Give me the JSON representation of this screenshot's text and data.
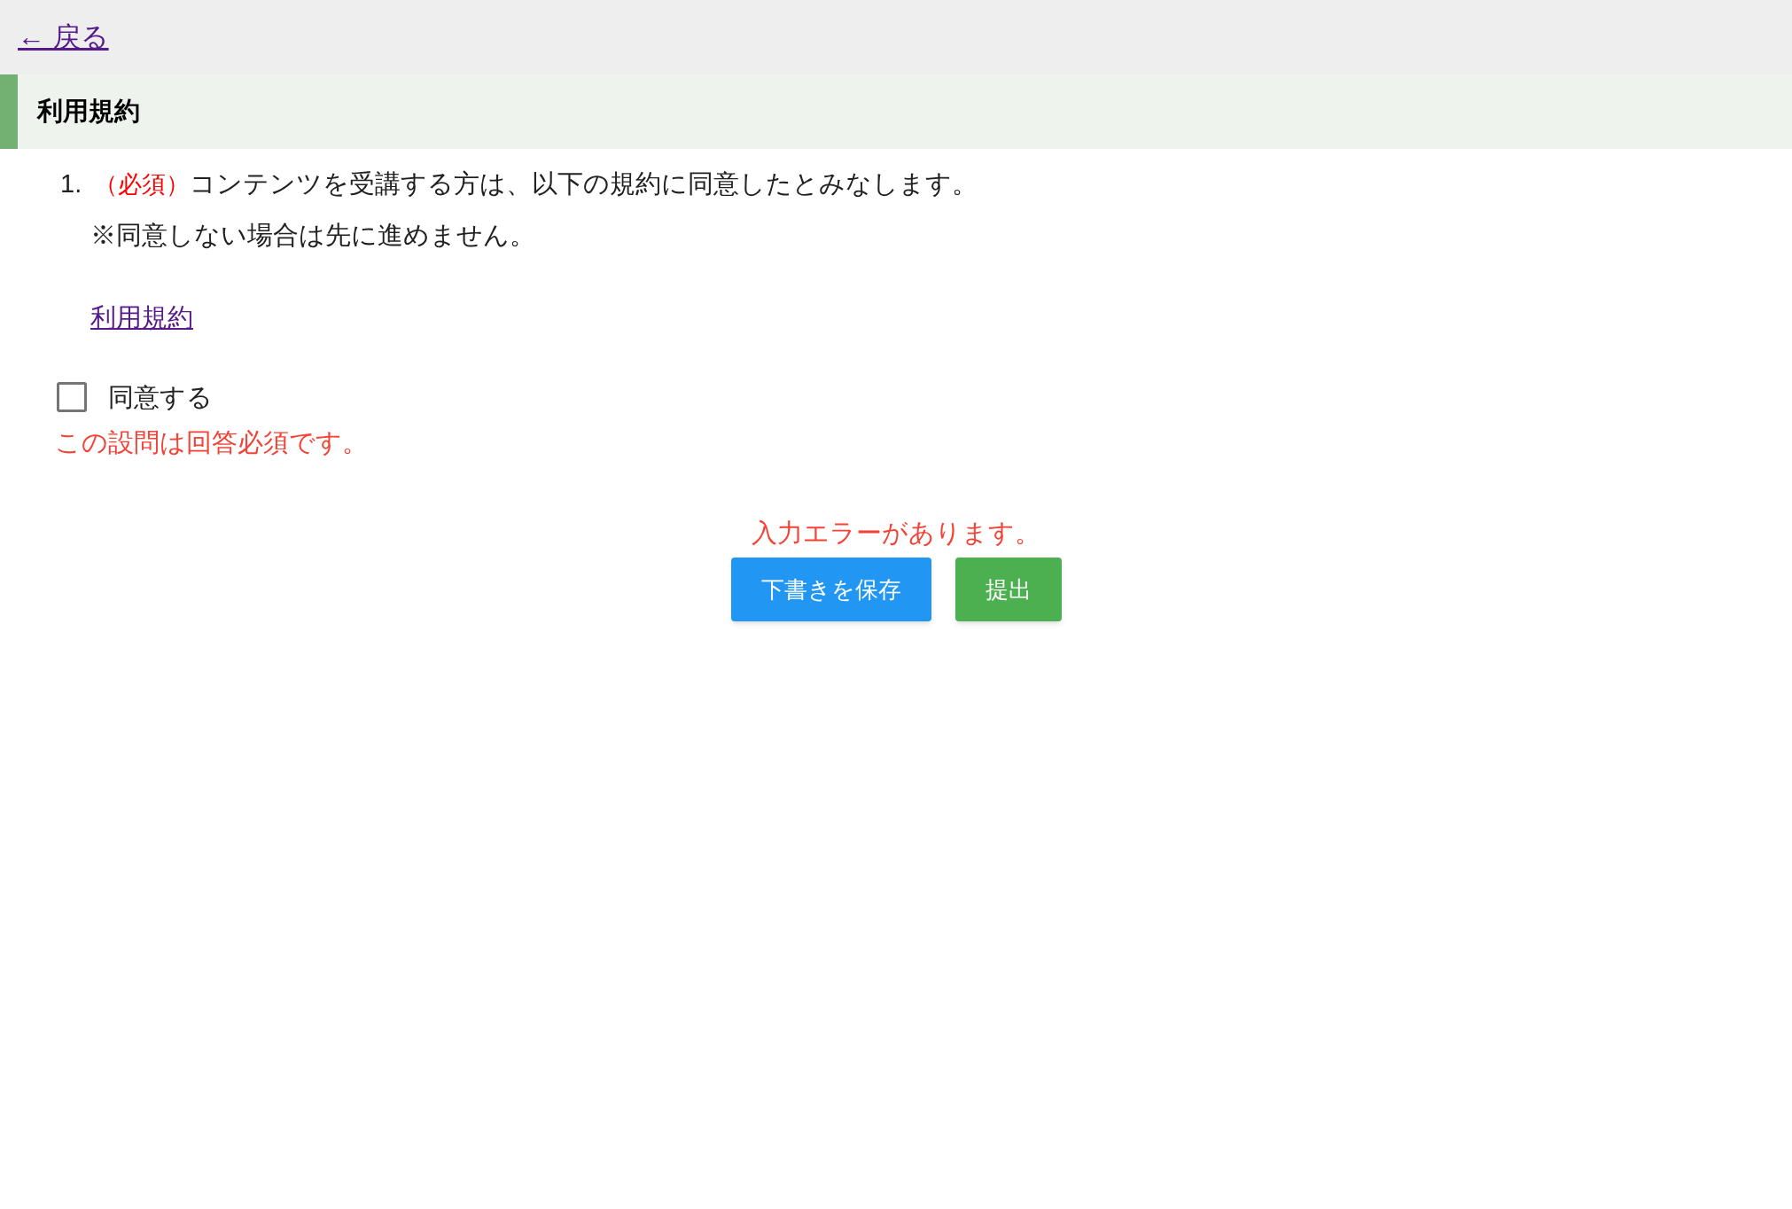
{
  "back_link": "← 戻る",
  "section": {
    "title": "利用規約"
  },
  "question": {
    "number": "1.",
    "required_tag": "（必須）",
    "text": "コンテンツを受講する方は、以下の規約に同意したとみなします。",
    "note": "※同意しない場合は先に進めません。",
    "link": "利用規約",
    "checkbox": {
      "label": "同意する",
      "checked": false
    },
    "error": "この設問は回答必須です。"
  },
  "form_error": "入力エラーがあります。",
  "buttons": [
    {
      "kind": "draft",
      "label": "下書きを保存"
    },
    {
      "kind": "submit",
      "label": "提出"
    }
  ]
}
